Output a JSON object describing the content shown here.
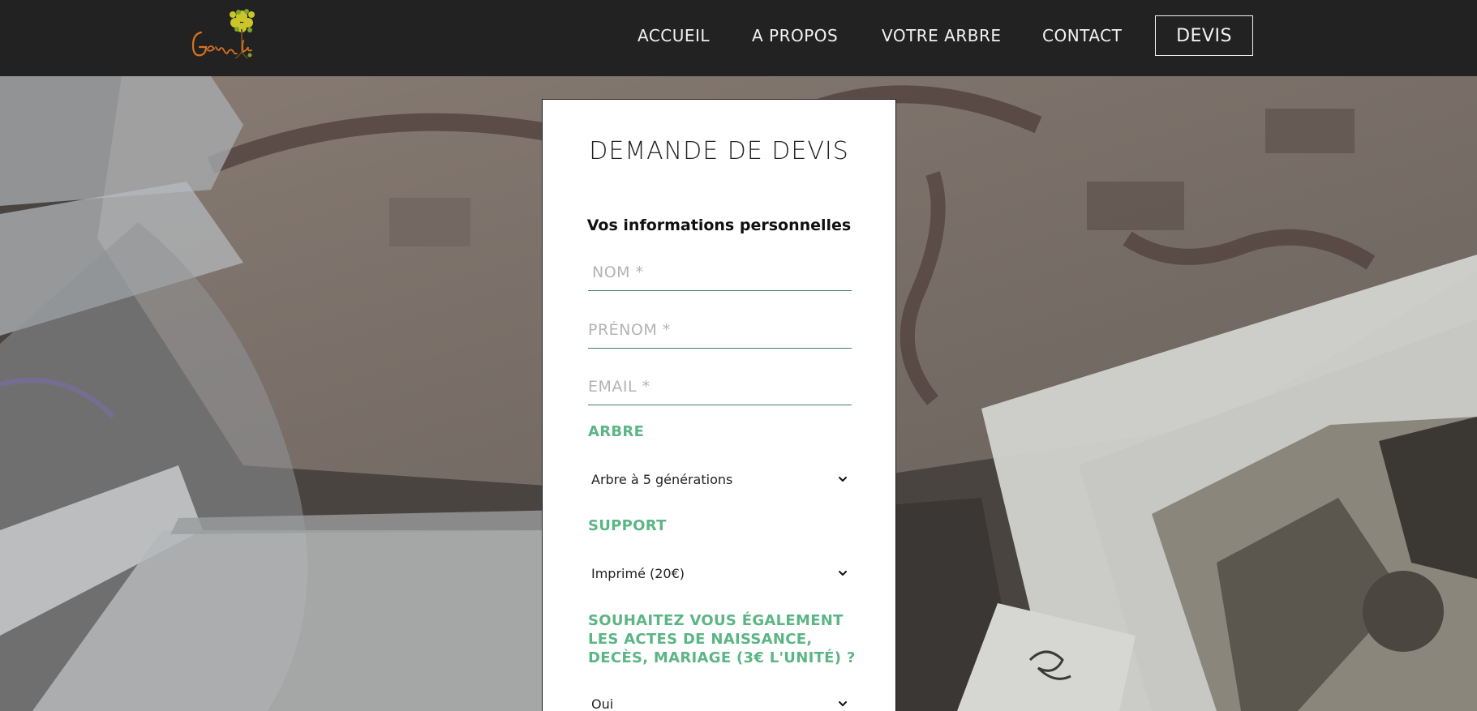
{
  "header": {
    "logo_text": "Genea'la",
    "nav": {
      "accueil": "ACCUEIL",
      "a_propos": "A PROPOS",
      "votre_arbre": "VOTRE ARBRE",
      "contact": "CONTACT",
      "devis": "DEVIS"
    }
  },
  "form": {
    "title": "DEMANDE DE DEVIS",
    "section_personal": "Vos informations personnelles",
    "nom_placeholder": "NOM *",
    "prenom_placeholder": "PRÉNOM *",
    "email_placeholder": "EMAIL *",
    "arbre_label": "ARBRE",
    "arbre_selected": "Arbre à 5 générations",
    "support_label": "SUPPORT",
    "support_selected": "Imprimé (20€)",
    "actes_label": "SOUHAITEZ VOUS ÉGALEMENT LES ACTES DE NAISSANCE, DECÈS, MARIAGE (3€ L'UNITÉ) ?",
    "actes_selected": "Oui"
  },
  "colors": {
    "header_bg": "#222222",
    "accent_green": "#5cb585",
    "field_underline": "#3f7d63"
  },
  "icons": {
    "select_arrow": "chevron-down-icon",
    "logo": "tree-logo-icon"
  }
}
